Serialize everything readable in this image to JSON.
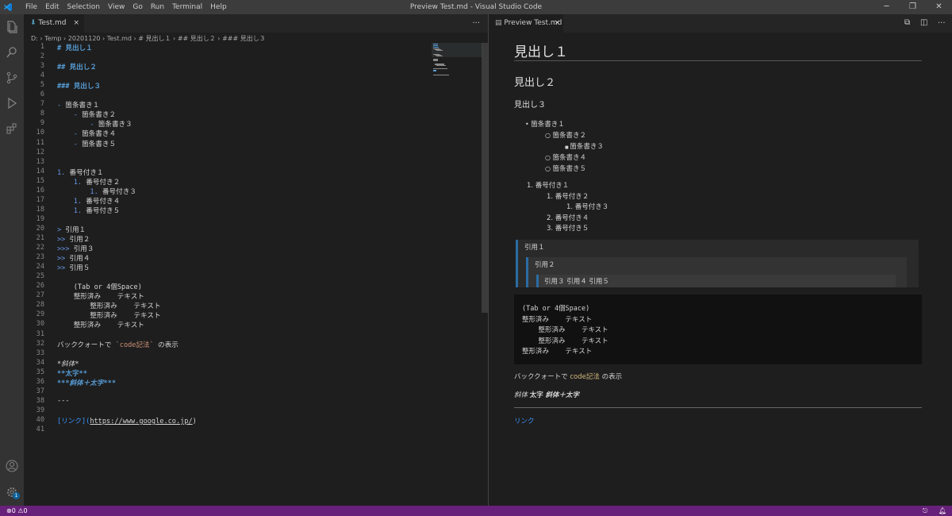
{
  "window": {
    "title": "Preview Test.md - Visual Studio Code",
    "menus": [
      "File",
      "Edit",
      "Selection",
      "View",
      "Go",
      "Run",
      "Terminal",
      "Help"
    ]
  },
  "editor": {
    "tab": "Test.md",
    "tab_close": "×",
    "more": "···",
    "breadcrumb": [
      "D:",
      "Temp",
      "20201120",
      "Test.md",
      "# 見出し１",
      "## 見出し２",
      "### 見出し３"
    ],
    "lines": [
      {
        "n": "1",
        "t": "# 見出し１",
        "c": "h"
      },
      {
        "n": "2",
        "t": "",
        "c": ""
      },
      {
        "n": "3",
        "t": "## 見出し２",
        "c": "h"
      },
      {
        "n": "4",
        "t": "",
        "c": ""
      },
      {
        "n": "5",
        "t": "### 見出し３",
        "c": "h"
      },
      {
        "n": "6",
        "t": "",
        "c": ""
      },
      {
        "n": "7",
        "t": "- 箇条書き１",
        "c": ""
      },
      {
        "n": "8",
        "t": "    - 箇条書き２",
        "c": ""
      },
      {
        "n": "9",
        "t": "        - 箇条書き３",
        "c": ""
      },
      {
        "n": "10",
        "t": "    - 箇条書き４",
        "c": ""
      },
      {
        "n": "11",
        "t": "    - 箇条書き５",
        "c": ""
      },
      {
        "n": "12",
        "t": "",
        "c": ""
      },
      {
        "n": "13",
        "t": "",
        "c": ""
      },
      {
        "n": "14",
        "t": "1. 番号付き１",
        "c": ""
      },
      {
        "n": "15",
        "t": "    1. 番号付き２",
        "c": ""
      },
      {
        "n": "16",
        "t": "        1. 番号付き３",
        "c": ""
      },
      {
        "n": "17",
        "t": "    1. 番号付き４",
        "c": ""
      },
      {
        "n": "18",
        "t": "    1. 番号付き５",
        "c": ""
      },
      {
        "n": "19",
        "t": "",
        "c": ""
      },
      {
        "n": "20",
        "t": "> 引用１",
        "c": ""
      },
      {
        "n": "21",
        "t": ">> 引用２",
        "c": ""
      },
      {
        "n": "22",
        "t": ">>> 引用３",
        "c": ""
      },
      {
        "n": "23",
        "t": ">> 引用４",
        "c": ""
      },
      {
        "n": "24",
        "t": ">> 引用５",
        "c": ""
      },
      {
        "n": "25",
        "t": "",
        "c": ""
      },
      {
        "n": "26",
        "t": "    (Tab or 4個Space)",
        "c": ""
      },
      {
        "n": "27",
        "t": "    整形済み    テキスト",
        "c": ""
      },
      {
        "n": "28",
        "t": "        整形済み    テキスト",
        "c": ""
      },
      {
        "n": "29",
        "t": "        整形済み    テキスト",
        "c": ""
      },
      {
        "n": "30",
        "t": "    整形済み    テキスト",
        "c": ""
      },
      {
        "n": "31",
        "t": "",
        "c": ""
      },
      {
        "n": "32",
        "t": "バッククォートで `code記法` の表示",
        "c": ""
      },
      {
        "n": "33",
        "t": "",
        "c": ""
      },
      {
        "n": "34",
        "t": "*斜体*",
        "c": "it"
      },
      {
        "n": "35",
        "t": "**太字**",
        "c": "bd"
      },
      {
        "n": "36",
        "t": "***斜体＋太字***",
        "c": "bd it"
      },
      {
        "n": "37",
        "t": "",
        "c": ""
      },
      {
        "n": "38",
        "t": "---",
        "c": ""
      },
      {
        "n": "39",
        "t": "",
        "c": ""
      },
      {
        "n": "40",
        "t": "[リンク](https://www.google.co.jp/)",
        "c": ""
      },
      {
        "n": "41",
        "t": "",
        "c": ""
      }
    ]
  },
  "preview": {
    "tab": "Preview Test.md",
    "tab_close": "×",
    "more": "···",
    "h1": "見出し１",
    "h2": "見出し２",
    "h3": "見出し３",
    "bullets": [
      {
        "mark": "•",
        "t": "箇条書き１",
        "lvl": 0
      },
      {
        "mark": "○",
        "t": "箇条書き２",
        "lvl": 1
      },
      {
        "mark": "■",
        "t": "箇条書き３",
        "lvl": 2
      },
      {
        "mark": "○",
        "t": "箇条書き４",
        "lvl": 1
      },
      {
        "mark": "○",
        "t": "箇条書き５",
        "lvl": 1
      }
    ],
    "numbered": [
      {
        "mark": "1.",
        "t": "番号付き１",
        "lvl": 0
      },
      {
        "mark": "1.",
        "t": "番号付き２",
        "lvl": 1
      },
      {
        "mark": "1.",
        "t": "番号付き３",
        "lvl": 2
      },
      {
        "mark": "2.",
        "t": "番号付き４",
        "lvl": 1
      },
      {
        "mark": "3.",
        "t": "番号付き５",
        "lvl": 1
      }
    ],
    "quote1": "引用１",
    "quote2": "引用２",
    "quote3": "引用３ 引用４ 引用５",
    "pre": [
      "(Tab or 4個Space)",
      "整形済み    テキスト",
      "    整形済み    テキスト",
      "    整形済み    テキスト",
      "整形済み    テキスト"
    ],
    "code_before": "バッククォートで ",
    "code": "code記法",
    "code_after": " の表示",
    "italic": "斜体",
    "bold": "太字",
    "bolditalic": "斜体＋太字",
    "link": "リンク"
  },
  "status": {
    "errors": "0",
    "warnings": "0",
    "badge": "1"
  }
}
